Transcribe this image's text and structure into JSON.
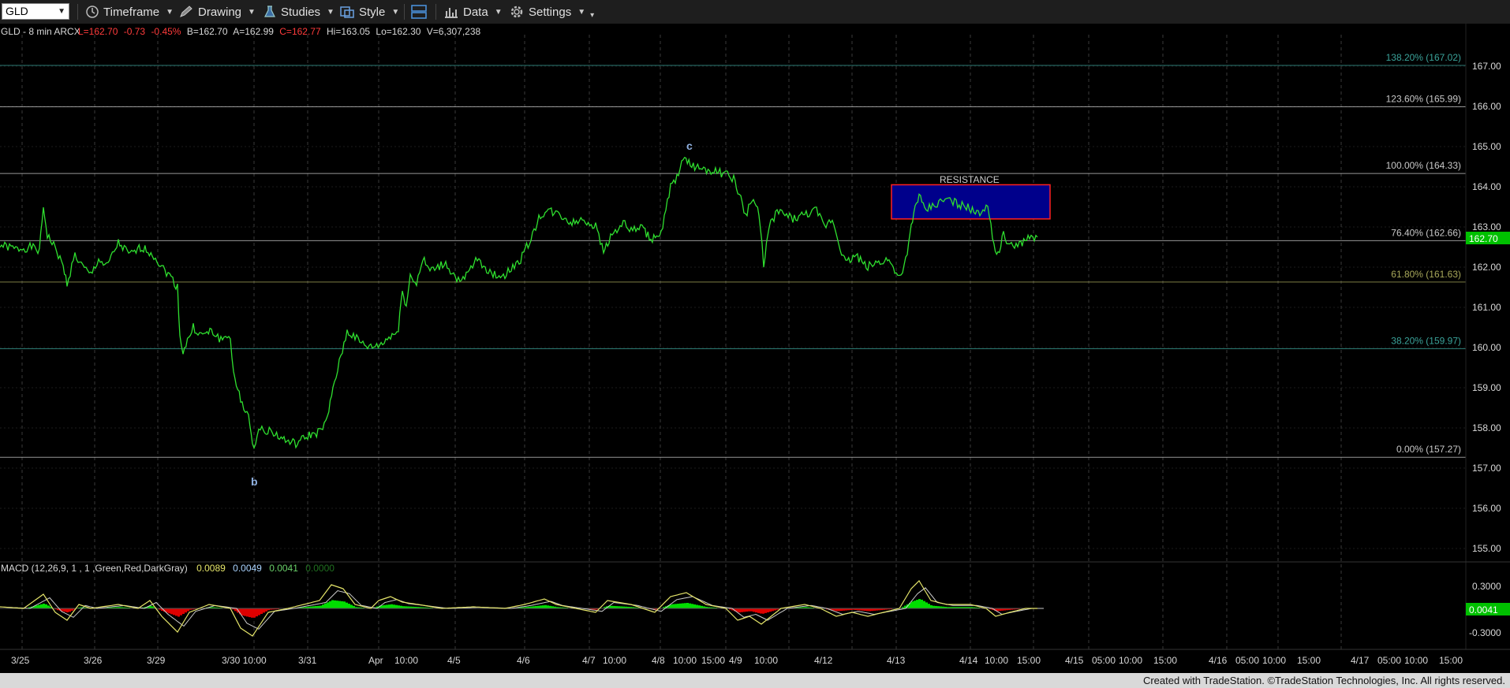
{
  "toolbar": {
    "symbol": "GLD",
    "timeframe": "Timeframe",
    "drawing": "Drawing",
    "studies": "Studies",
    "style": "Style",
    "data": "Data",
    "settings": "Settings"
  },
  "header": {
    "symbol_info": "GLD - 8 min  ARCX",
    "last": "L=162.70",
    "change": "-0.73",
    "pct": "-0.45%",
    "bid": "B=162.70",
    "ask": "A=162.99",
    "close": "C=162.77",
    "hi": "Hi=163.05",
    "lo": "Lo=162.30",
    "volume": "V=6,307,238"
  },
  "colors": {
    "price": "#2fe02f",
    "macd_line": "#e6e66a",
    "macd_signal": "#cccccc",
    "hist_up": "#00dd00",
    "hist_down": "#dd0000",
    "red_text": "#ff3b3b",
    "fib_line": "#6d8a8a",
    "resistance_fill": "#00008b",
    "resistance_border": "#ff2020"
  },
  "fib_levels": [
    {
      "label": "138.20% (167.02)",
      "price": 167.02,
      "color": "#3aa39a"
    },
    {
      "label": "123.60% (165.99)",
      "price": 165.99,
      "color": "#c8c8c8"
    },
    {
      "label": "100.00% (164.33)",
      "price": 164.33,
      "color": "#c8c8c8"
    },
    {
      "label": "76.40% (162.66)",
      "price": 162.66,
      "color": "#c8c8c8"
    },
    {
      "label": "61.80% (161.63)",
      "price": 161.63,
      "color": "#a8a85a"
    },
    {
      "label": "38.20% (159.97)",
      "price": 159.97,
      "color": "#3aa39a"
    },
    {
      "label": "0.00% (157.27)",
      "price": 157.27,
      "color": "#c8c8c8"
    }
  ],
  "price_axis": {
    "ticks": [
      "167.00",
      "166.00",
      "165.00",
      "164.00",
      "163.00",
      "162.00",
      "161.00",
      "160.00",
      "159.00",
      "158.00",
      "157.00",
      "156.00",
      "155.00"
    ],
    "range": [
      154.7,
      167.7
    ],
    "last_price_label": "162.70"
  },
  "annotations": {
    "wave_b": "b",
    "wave_c": "c",
    "resistance": "RESISTANCE"
  },
  "resistance_zone": {
    "high": 164.05,
    "low": 163.2
  },
  "macd": {
    "label": "MACD (12,26,9, 1 , 1 ,Green,Red,DarkGray)",
    "v1": "0.0089",
    "v2": "0.0049",
    "v3": "0.0041",
    "v4": "0.0000",
    "ticks": [
      "0.3000",
      "-0.3000"
    ],
    "last_value_label": "0.0041"
  },
  "time_axis": {
    "labels": [
      "3/25",
      "3/26",
      "3/29",
      "3/30 10:00",
      "3/31",
      "Apr",
      "10:00",
      "4/5",
      "4/6",
      "4/7",
      "10:00",
      "4/8",
      "10:00",
      "15:00",
      "4/9",
      "10:00",
      "4/12",
      "4/13",
      "4/14",
      "10:00",
      "15:00",
      "4/15",
      "05:00",
      "10:00",
      "15:00",
      "4/16",
      "05:00",
      "10:00",
      "15:00",
      "4/17",
      "05:00",
      "10:00",
      "15:00"
    ]
  },
  "footer": "Created with TradeStation. ©TradeStation Technologies, Inc. All rights reserved."
}
